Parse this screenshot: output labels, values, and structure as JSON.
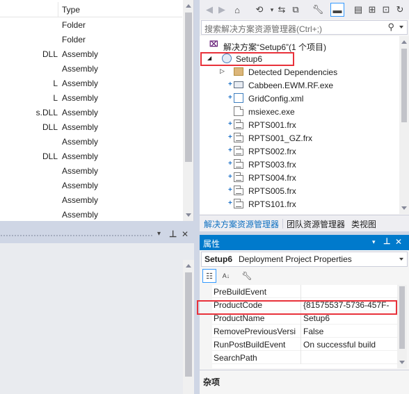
{
  "file_list": {
    "type_header": "Type",
    "rows": [
      {
        "name": "",
        "type": "Folder"
      },
      {
        "name": "",
        "type": "Folder"
      },
      {
        "name": "DLL",
        "type": "Assembly"
      },
      {
        "name": "",
        "type": "Assembly"
      },
      {
        "name": "L",
        "type": "Assembly"
      },
      {
        "name": "L",
        "type": "Assembly"
      },
      {
        "name": "s.DLL",
        "type": "Assembly"
      },
      {
        "name": "DLL",
        "type": "Assembly"
      },
      {
        "name": "",
        "type": "Assembly"
      },
      {
        "name": "DLL",
        "type": "Assembly"
      },
      {
        "name": "",
        "type": "Assembly"
      },
      {
        "name": "",
        "type": "Assembly"
      },
      {
        "name": "",
        "type": "Assembly"
      },
      {
        "name": "",
        "type": "Assembly"
      }
    ]
  },
  "left_bottom": {
    "pin_glyph": "❘",
    "dropdown_glyph": "▾",
    "close_glyph": "✕"
  },
  "solution_explorer": {
    "search_placeholder": "搜索解决方案资源管理器(Ctrl+;)",
    "solution_label": "解决方案“Setup6”(1 个项目)",
    "project_label": "Setup6",
    "items": [
      {
        "label": "Detected Dependencies",
        "icon": "folder-icon"
      },
      {
        "label": "Cabbeen.EWM.RF.exe",
        "icon": "exe-icon"
      },
      {
        "label": "GridConfig.xml",
        "icon": "xml-icon"
      },
      {
        "label": "msiexec.exe",
        "icon": "file-icon"
      },
      {
        "label": "RPTS001.frx",
        "icon": "frx-icon"
      },
      {
        "label": "RPTS001_GZ.frx",
        "icon": "frx-icon"
      },
      {
        "label": "RPTS002.frx",
        "icon": "frx-icon"
      },
      {
        "label": "RPTS003.frx",
        "icon": "frx-icon"
      },
      {
        "label": "RPTS004.frx",
        "icon": "frx-icon"
      },
      {
        "label": "RPTS005.frx",
        "icon": "frx-icon"
      },
      {
        "label": "RPTS101.frx",
        "icon": "frx-icon"
      }
    ],
    "tabs": [
      "解决方案资源管理器",
      "团队资源管理器",
      "类视图"
    ],
    "toolbar_icons": [
      "back-icon",
      "forward-icon",
      "home-icon",
      "history-icon",
      "sync-icon",
      "collapse-icon",
      "properties-icon",
      "pin-tab-icon",
      "show-files-icon",
      "new-folder-icon",
      "more-icon"
    ]
  },
  "properties": {
    "title": "属性",
    "object_name": "Setup6",
    "object_type": "Deployment Project Properties",
    "rows": [
      {
        "name": "PreBuildEvent",
        "value": ""
      },
      {
        "name": "ProductCode",
        "value": "{81575537-5736-457F-"
      },
      {
        "name": "ProductName",
        "value": "Setup6"
      },
      {
        "name": "RemovePreviousVersi",
        "value": "False"
      },
      {
        "name": "RunPostBuildEvent",
        "value": "On successful build"
      },
      {
        "name": "SearchPath",
        "value": ""
      }
    ],
    "description": "杂项"
  },
  "colors": {
    "accent": "#007acc",
    "highlight_box": "#e8313a",
    "chrome": "#cfd6e5"
  }
}
